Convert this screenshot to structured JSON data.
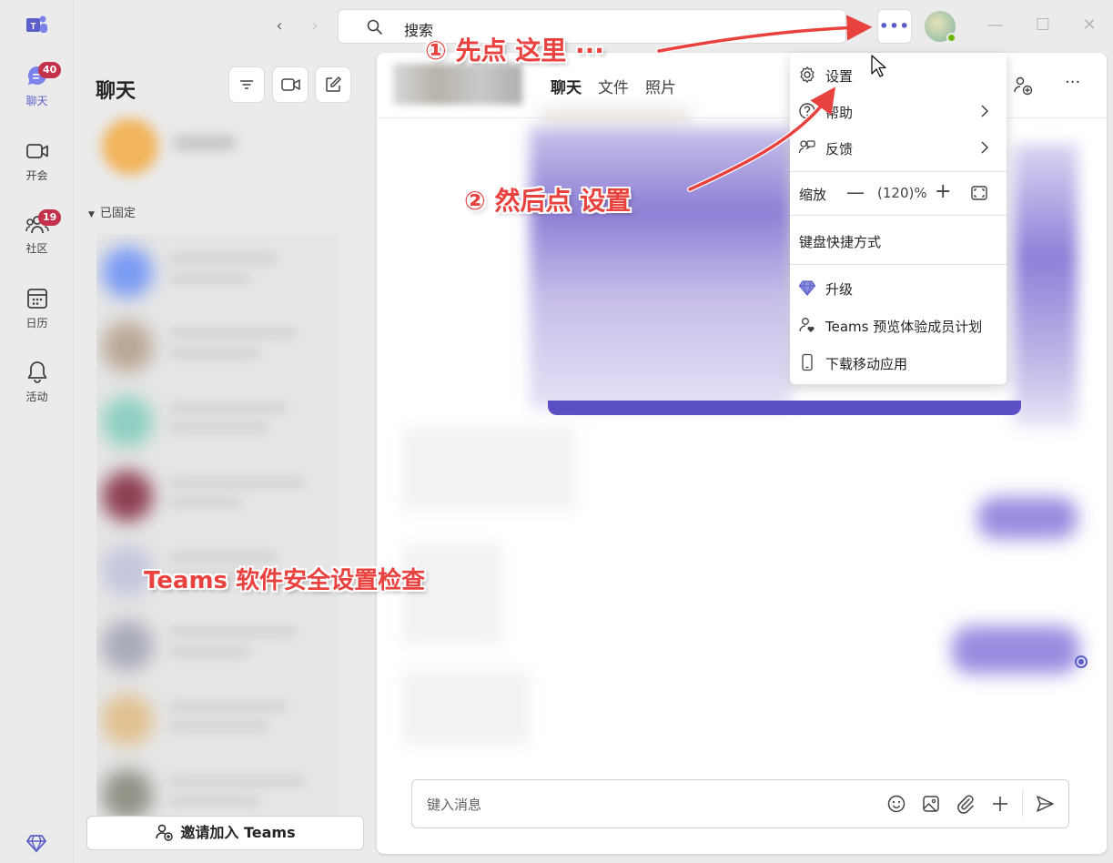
{
  "app": {
    "accent": "#5b5fc7",
    "badge_color": "#c4314b"
  },
  "rail": [
    {
      "label": "聊天",
      "icon": "chat-icon",
      "badge": "40"
    },
    {
      "label": "开会",
      "icon": "video-icon",
      "badge": ""
    },
    {
      "label": "社区",
      "icon": "community-icon",
      "badge": "19"
    },
    {
      "label": "日历",
      "icon": "calendar-icon",
      "badge": ""
    },
    {
      "label": "活动",
      "icon": "bell-icon",
      "badge": ""
    }
  ],
  "search": {
    "placeholder": "搜索"
  },
  "more_button": "•••",
  "window_controls": {
    "minimize": "—",
    "maximize": "☐",
    "close": "✕"
  },
  "chat_panel": {
    "title": "聊天",
    "pinned_label": "已固定",
    "invite_label": "邀请加入 Teams"
  },
  "main": {
    "tabs": [
      "聊天",
      "文件",
      "照片"
    ],
    "composer_placeholder": "键入消息",
    "header_more": "···"
  },
  "menu": {
    "settings": "设置",
    "help": "帮助",
    "feedback": "反馈",
    "zoom_label": "缩放",
    "zoom_minus": "—",
    "zoom_value": "(120)%",
    "zoom_plus": "+",
    "keyboard_shortcuts": "键盘快捷方式",
    "upgrade": "升级",
    "preview_program": "Teams 预览体验成员计划",
    "download_mobile": "下载移动应用"
  },
  "annotations": {
    "step1": "① 先点 这里 ···",
    "step2": "② 然后点 设置",
    "caption": "Teams 软件安全设置检查",
    "color": "#e8413e"
  }
}
